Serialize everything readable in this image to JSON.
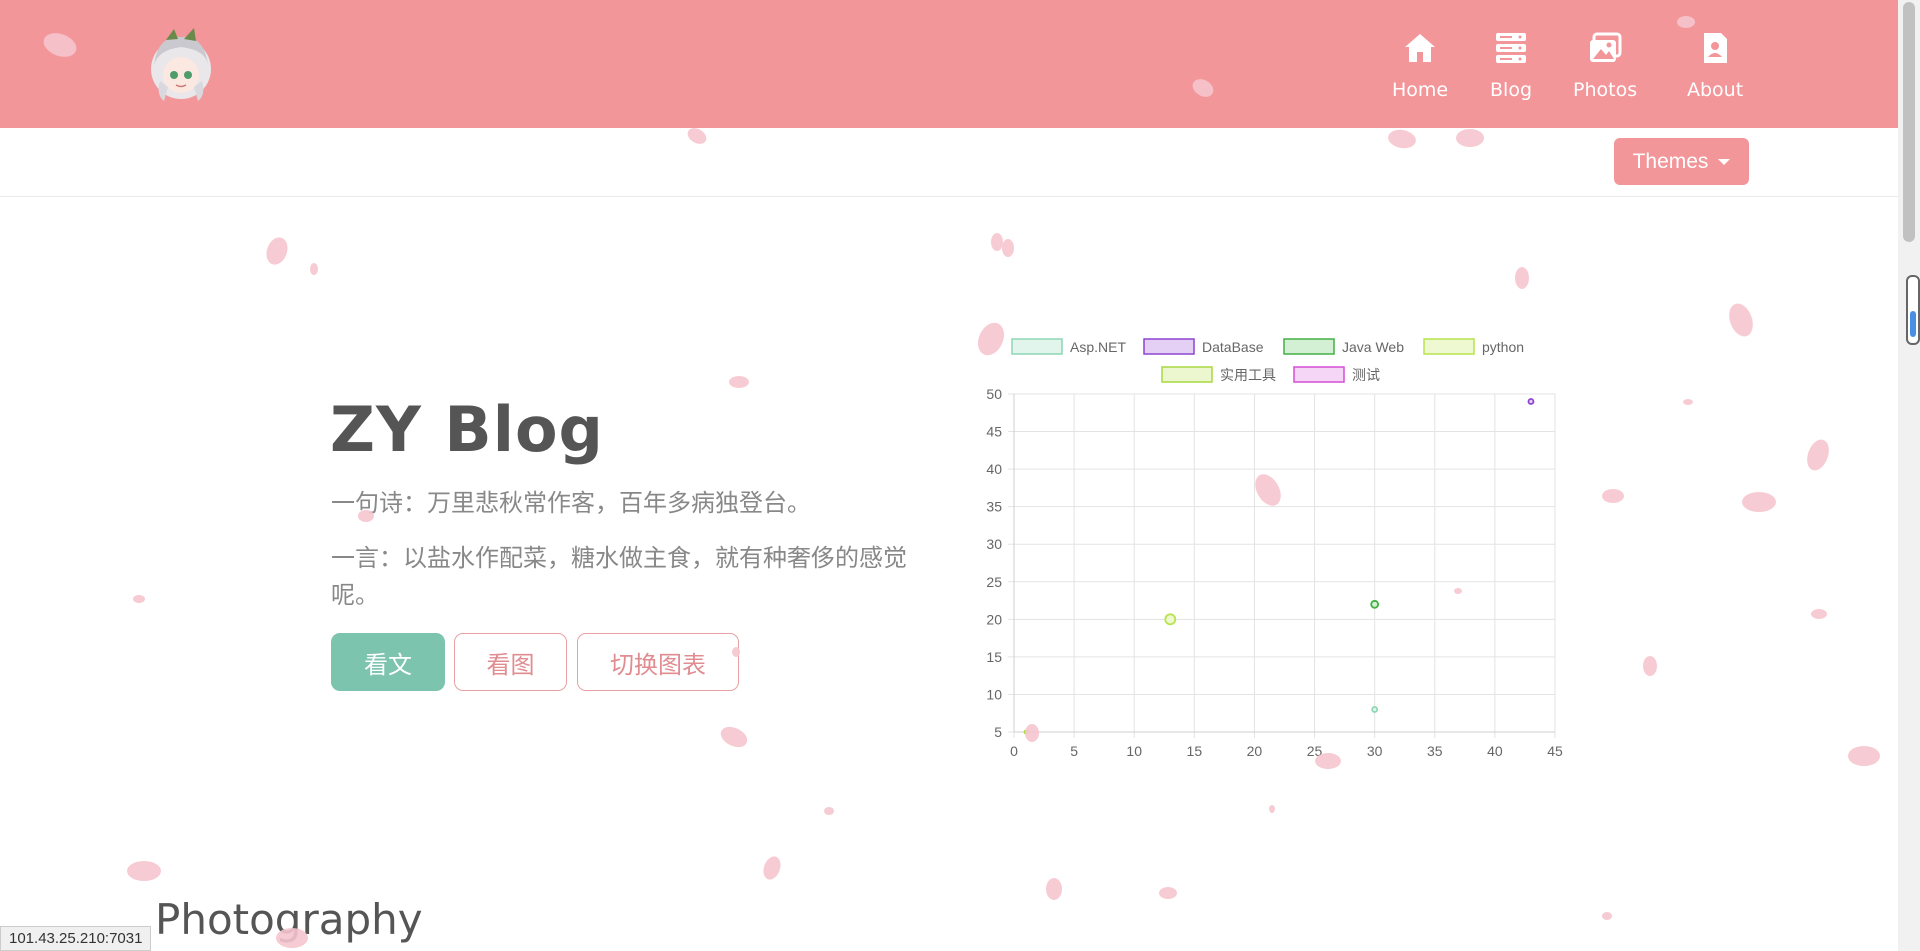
{
  "nav": {
    "items": [
      {
        "label": "Home",
        "icon": "home-icon"
      },
      {
        "label": "Blog",
        "icon": "server-icon"
      },
      {
        "label": "Photos",
        "icon": "photos-icon"
      },
      {
        "label": "About",
        "icon": "contact-icon"
      }
    ],
    "themes_label": "Themes"
  },
  "hero": {
    "title": "ZY Blog",
    "poem": "一句诗：万里悲秋常作客，百年多病独登台。",
    "quote": "一言：以盐水作配菜，糖水做主食，就有种奢侈的感觉呢。",
    "buttons": {
      "read": "看文",
      "pics": "看图",
      "switch": "切换图表"
    }
  },
  "section": {
    "title": "Photography"
  },
  "status": {
    "url": "101.43.25.210:7031"
  },
  "colors": {
    "accent": "#f2969a",
    "teal": "#7cc4ad"
  },
  "chart_data": {
    "type": "scatter",
    "x_ticks": [
      0,
      5,
      10,
      15,
      20,
      25,
      30,
      35,
      40,
      45
    ],
    "y_ticks": [
      5,
      10,
      15,
      20,
      25,
      30,
      35,
      40,
      45,
      50
    ],
    "xlim": [
      0,
      45
    ],
    "ylim": [
      5,
      50
    ],
    "grid": true,
    "legend_position": "top",
    "series": [
      {
        "name": "Asp.NET",
        "stroke": "#8fd6b5",
        "fill": "#e1f5ec",
        "points": [
          {
            "x": 30,
            "y": 8,
            "r": 2.5
          }
        ]
      },
      {
        "name": "DataBase",
        "stroke": "#8e44d0",
        "fill": "#e4cff5",
        "points": [
          {
            "x": 43,
            "y": 49,
            "r": 2.5
          }
        ]
      },
      {
        "name": "Java Web",
        "stroke": "#43b043",
        "fill": "#d4f0d4",
        "points": [
          {
            "x": 30,
            "y": 22,
            "r": 3.5
          }
        ]
      },
      {
        "name": "python",
        "stroke": "#b9e34d",
        "fill": "#eef9d2",
        "points": [
          {
            "x": 13,
            "y": 20,
            "r": 5
          }
        ]
      },
      {
        "name": "实用工具",
        "stroke": "#a8d840",
        "fill": "#ecf6cf",
        "points": [
          {
            "x": 1,
            "y": 5,
            "r": 1.5
          }
        ]
      },
      {
        "name": "测试",
        "stroke": "#d64fd6",
        "fill": "#f6d6f6",
        "points": []
      }
    ]
  }
}
